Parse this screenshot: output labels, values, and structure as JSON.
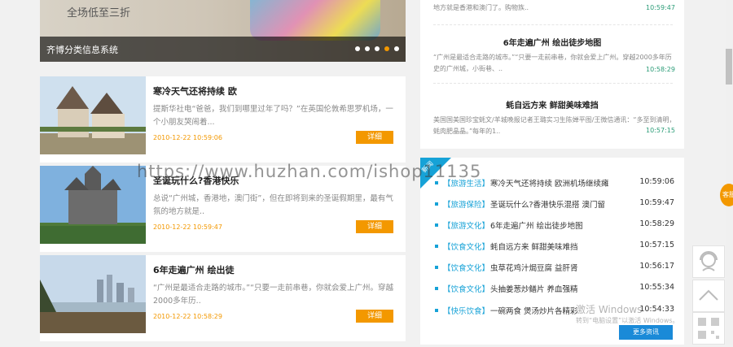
{
  "banner": {
    "promo_text": "全场低至三折",
    "caption": "齐博分类信息系统",
    "dots": 5,
    "active_dot": 4
  },
  "cards": [
    {
      "title": "寒冷天气还将持续 欧",
      "desc": "提斯华社电“爸爸，我们到哪里过年了吗？”在英国伦敦希思罗机场，一个小朋友哭闹着...",
      "date": "2010-12-22 10:59:06",
      "button": "详细"
    },
    {
      "title": "圣诞玩什么?香港快乐",
      "desc": "总说“广州城，香港地，澳门街”，但在即将到来的圣诞假期里，最有气氛的地方就是..",
      "date": "2010-12-22 10:59:47",
      "button": "详细"
    },
    {
      "title": "6年走遍广州 绘出徒",
      "desc": "“广州是最适合走路的城市。”“只要一走前串巷，你就会爱上广州。穿越2000多年历..",
      "date": "2010-12-22 10:58:29",
      "button": "详细"
    }
  ],
  "right_top": {
    "item0_text": "地方就是香港和澳门了。购物族..",
    "item0_time": "10:59:47",
    "item1_title": "6年走遍广州 绘出徒步地图",
    "item1_text": "“广州是最适合走路的城市。”“只要一走前串巷，你就会爱上广州。穿越2000多年历史的广州城，小街巷、..",
    "item1_time": "10:58:29",
    "item2_title": "蚝自远方来 鲜甜美味难挡",
    "item2_text": "美国国美国珍宝蚝文/羊城晚报记者王璐实习生陈婵平图/王微信通讯：“多至到清明，蚝肉肥晶晶。”每年的1..",
    "item2_time": "10:57:15"
  },
  "news": {
    "ribbon": "新闻",
    "rows": [
      {
        "cat": "【旅游生活】",
        "title": "寒冷天气还将持续 欧洲机场继续瘫",
        "time": "10:59:06"
      },
      {
        "cat": "【旅游保险】",
        "title": "圣诞玩什么?香港快乐混搭 澳门留",
        "time": "10:59:47"
      },
      {
        "cat": "【旅游文化】",
        "title": "6年走遍广州 绘出徒步地图",
        "time": "10:58:29"
      },
      {
        "cat": "【饮食文化】",
        "title": "蚝自远方来 鲜甜美味难挡",
        "time": "10:57:15"
      },
      {
        "cat": "【饮食文化】",
        "title": "虫草花鸡汁焗豆腐 益肝肾",
        "time": "10:56:17"
      },
      {
        "cat": "【饮食文化】",
        "title": "头抽姜葱炒鳝片 养血强精",
        "time": "10:55:34"
      },
      {
        "cat": "【快乐饮食】",
        "title": "一碗两食 煲汤炒片各精彩",
        "time": "10:54:33"
      }
    ],
    "more": "更多资讯"
  },
  "watermark": {
    "line1": "激活 Windows",
    "line2": "转到“电脑设置”以激活 Windows。",
    "url": "https://www.huzhan.com/ishop11135"
  },
  "side": {
    "tab_label": "客服"
  },
  "colors": {
    "accent_orange": "#f39800",
    "accent_blue": "#16a2d7",
    "time_green": "#2b9c77"
  }
}
